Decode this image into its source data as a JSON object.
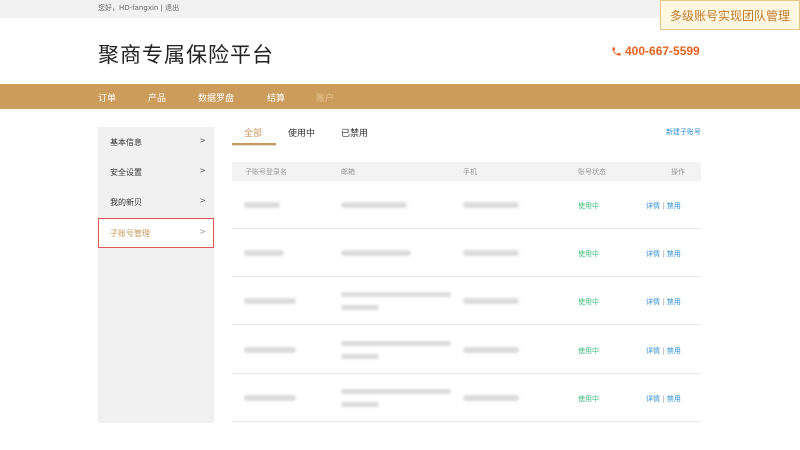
{
  "topbar": {
    "greeting": "您好，HD-fangxin | 退出"
  },
  "callout": {
    "text": "多级账号实现团队管理"
  },
  "header": {
    "brand": "聚商专属保险平台",
    "phone": "400-667-5599",
    "accent_color": "#e8621f"
  },
  "nav": {
    "bg_color": "#cc9c5c",
    "items": [
      "订单",
      "产品",
      "数据罗盘",
      "结算",
      "账户"
    ]
  },
  "sidebar": {
    "items": [
      {
        "label": "基本信息",
        "arrow": ">"
      },
      {
        "label": "安全设置",
        "arrow": ">"
      },
      {
        "label": "我的新贝",
        "arrow": ">"
      },
      {
        "label": "子账号管理",
        "arrow": ">",
        "active": true
      }
    ]
  },
  "tabs": {
    "items": [
      "全部",
      "使用中",
      "已禁用"
    ],
    "new_link": "新建子账号"
  },
  "table": {
    "headers": [
      "子账号登录名",
      "邮箱",
      "手机",
      "账号状态",
      "操作"
    ],
    "rows": [
      {
        "status": "使用中",
        "detail": "详情",
        "sep": "|",
        "disable": "禁用"
      },
      {
        "status": "使用中",
        "detail": "详情",
        "sep": "|",
        "disable": "禁用"
      },
      {
        "status": "使用中",
        "detail": "详情",
        "sep": "|",
        "disable": "禁用"
      },
      {
        "status": "使用中",
        "detail": "详情",
        "sep": "|",
        "disable": "禁用"
      },
      {
        "status": "使用中",
        "detail": "详情",
        "sep": "|",
        "disable": "禁用"
      }
    ]
  }
}
